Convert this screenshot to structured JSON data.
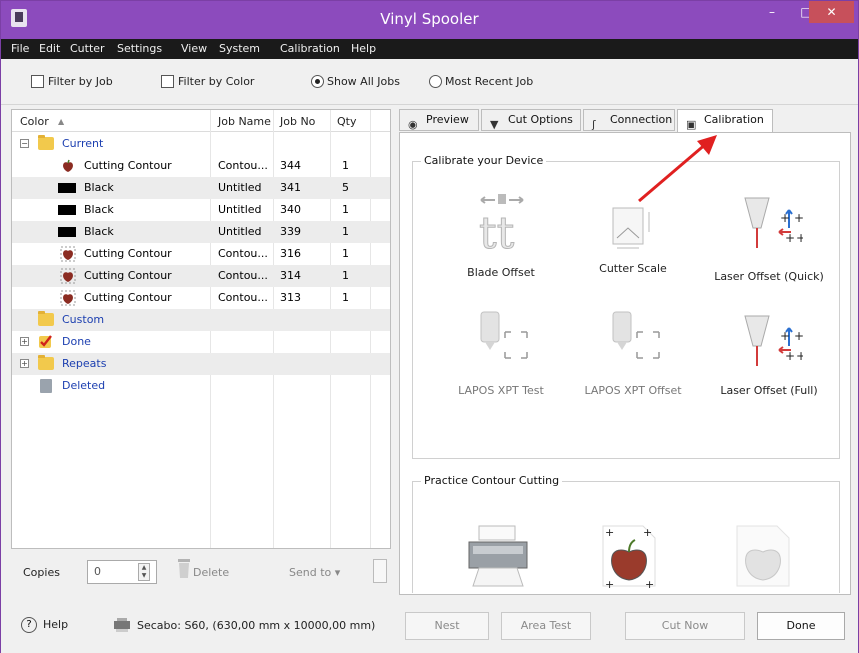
{
  "window": {
    "title": "Vinyl Spooler",
    "min_glyph": "–",
    "max_glyph": "□",
    "close_glyph": "✕"
  },
  "menu": [
    "File",
    "Edit",
    "Cutter",
    "Settings",
    "View",
    "System",
    "Calibration",
    "Help"
  ],
  "filters": {
    "filter_by_job": "Filter by Job",
    "filter_by_color": "Filter by Color",
    "show_all_jobs": "Show All Jobs",
    "most_recent_job": "Most Recent Job"
  },
  "list": {
    "columns": [
      "Color",
      "Job Name",
      "Job No",
      "Qty"
    ],
    "sort_glyph": "▲",
    "group_current": "Current",
    "rows": [
      {
        "color": "Cutting Contour",
        "job": "Contou...",
        "no": "344",
        "qty": "1"
      },
      {
        "color": "Black",
        "job": "Untitled",
        "no": "341",
        "qty": "5"
      },
      {
        "color": "Black",
        "job": "Untitled",
        "no": "340",
        "qty": "1"
      },
      {
        "color": "Black",
        "job": "Untitled",
        "no": "339",
        "qty": "1"
      },
      {
        "color": "Cutting Contour",
        "job": "Contou...",
        "no": "316",
        "qty": "1"
      },
      {
        "color": "Cutting Contour",
        "job": "Contou...",
        "no": "314",
        "qty": "1"
      },
      {
        "color": "Cutting Contour",
        "job": "Contou...",
        "no": "313",
        "qty": "1"
      }
    ],
    "group_custom": "Custom",
    "group_done": "Done",
    "group_repeats": "Repeats",
    "group_deleted": "Deleted",
    "expand_glyph": "+",
    "collapse_glyph": "−"
  },
  "copies": {
    "label": "Copies",
    "value": "0",
    "delete": "Delete",
    "send_to": "Send to ▾"
  },
  "tabs": [
    "Preview",
    "Cut Options",
    "Connection",
    "Calibration"
  ],
  "calibration": {
    "group_title": "Calibrate your Device",
    "tools": [
      "Blade Offset",
      "Cutter Scale",
      "Laser Offset (Quick)",
      "LAPOS XPT Test",
      "LAPOS XPT Offset",
      "Laser Offset (Full)"
    ],
    "practice_title": "Practice Contour Cutting"
  },
  "status": {
    "help": "Help",
    "help_glyph": "?",
    "cutter_info": "Secabo: S60,  (630,00 mm x 10000,00 mm)",
    "nest": "Nest",
    "area_test": "Area Test",
    "cut_now": "Cut Now",
    "done": "Done"
  },
  "colors": {
    "titlebar": "#8c4bbd",
    "close": "#c7505b",
    "group_text": "#1c3fb0",
    "arrow": "#e02020"
  }
}
